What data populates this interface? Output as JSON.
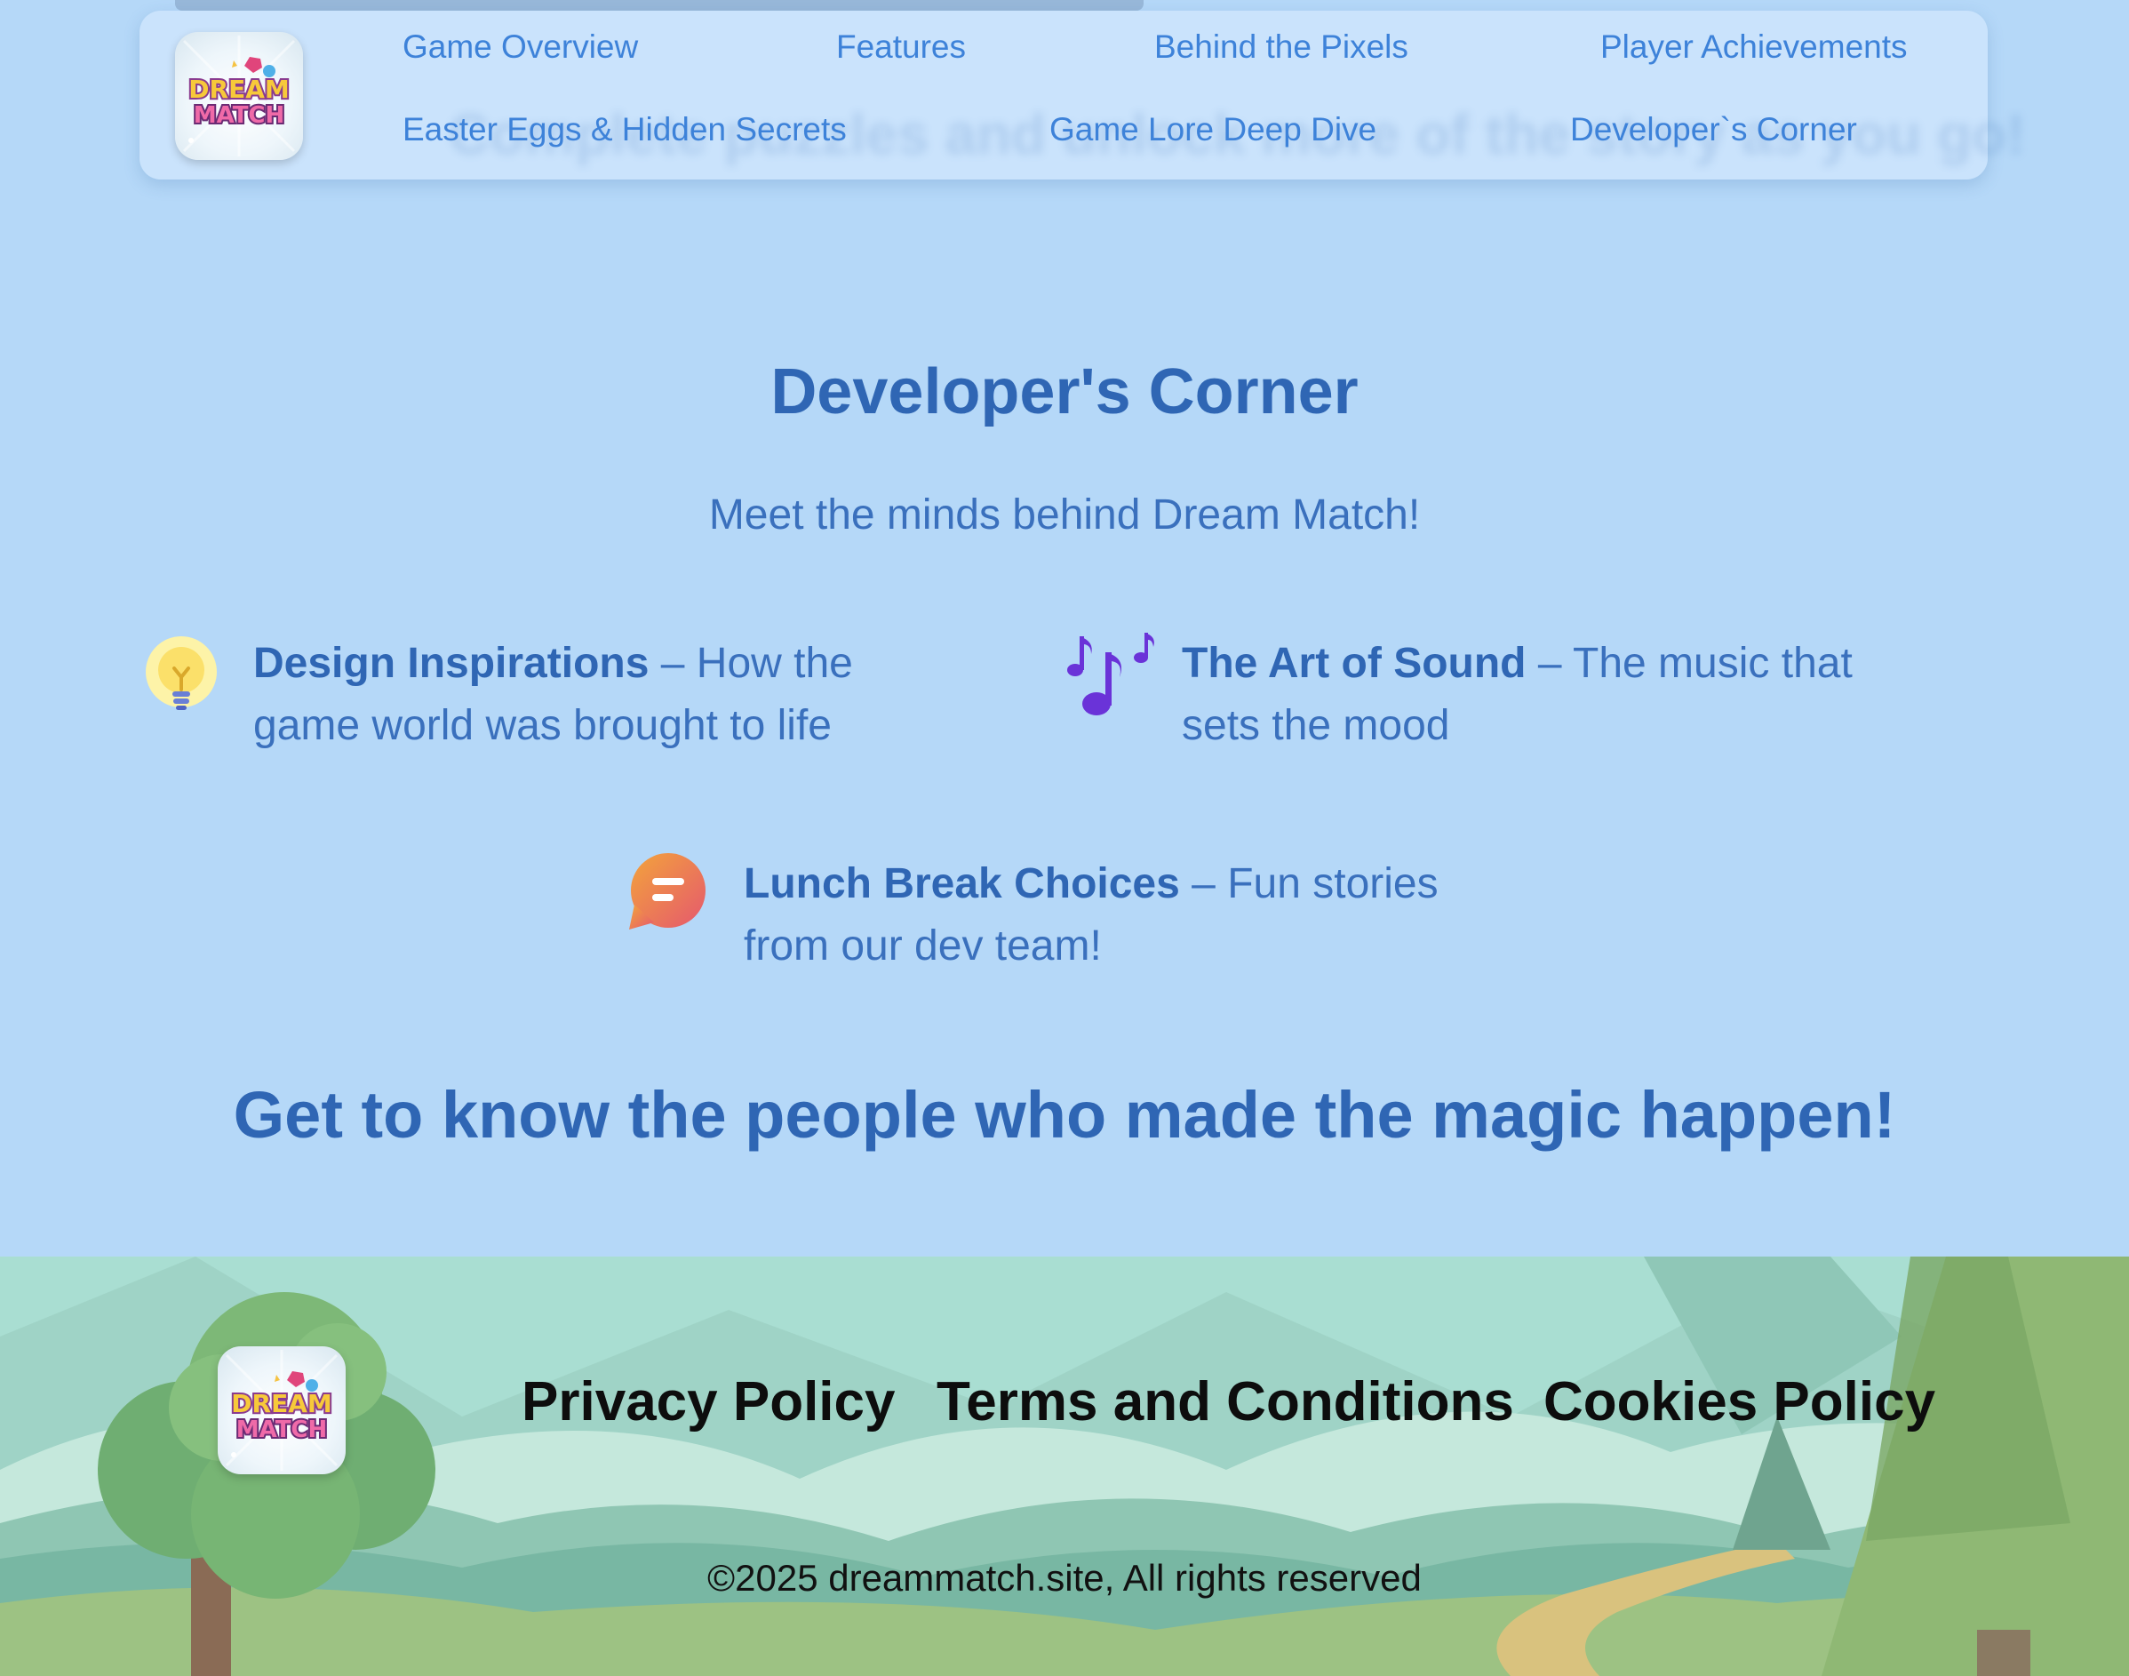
{
  "header": {
    "logo_text_top": "DREAM",
    "logo_text_bottom": "MATCH",
    "ghost_text": "Complete puzzles and unlock more of the story as you go!",
    "nav": [
      {
        "label": "Game Overview"
      },
      {
        "label": "Features"
      },
      {
        "label": "Behind the Pixels"
      },
      {
        "label": "Player Achievements"
      },
      {
        "label": "Easter Eggs & Hidden Secrets"
      },
      {
        "label": "Game Lore Deep Dive"
      },
      {
        "label": "Developer`s Corner"
      }
    ]
  },
  "main": {
    "title": "Developer's Corner",
    "subtitle": "Meet the minds behind Dream Match!",
    "features": [
      {
        "icon": "lightbulb-icon",
        "title": "Design Inspirations",
        "separator": " – ",
        "description_line1": "How the",
        "description_line2": "game world was brought to life"
      },
      {
        "icon": "musical-notes-icon",
        "title": "The Art of Sound",
        "separator": " – ",
        "description_line1": "The music that",
        "description_line2": "sets the mood"
      },
      {
        "icon": "chat-bubble-icon",
        "title": "Lunch Break Choices",
        "separator": " – ",
        "description_line1": "Fun stories",
        "description_line2": "from our dev team!"
      }
    ],
    "tagline": "Get to know the people who made the magic happen!"
  },
  "footer": {
    "logo_text_top": "DREAM",
    "logo_text_bottom": "MATCH",
    "links": [
      {
        "label": "Privacy Policy"
      },
      {
        "label": "Terms and Conditions"
      },
      {
        "label": "Cookies Policy"
      }
    ],
    "copyright": "©2025 dreammatch.site, All rights reserved"
  },
  "colors": {
    "page_background": "#b5d8f8",
    "header_background": "#cce4fc",
    "nav_link": "#3d82d9",
    "heading": "#2f66b4",
    "body_text": "#3a70bd",
    "footer_text": "#0d0d0d"
  }
}
